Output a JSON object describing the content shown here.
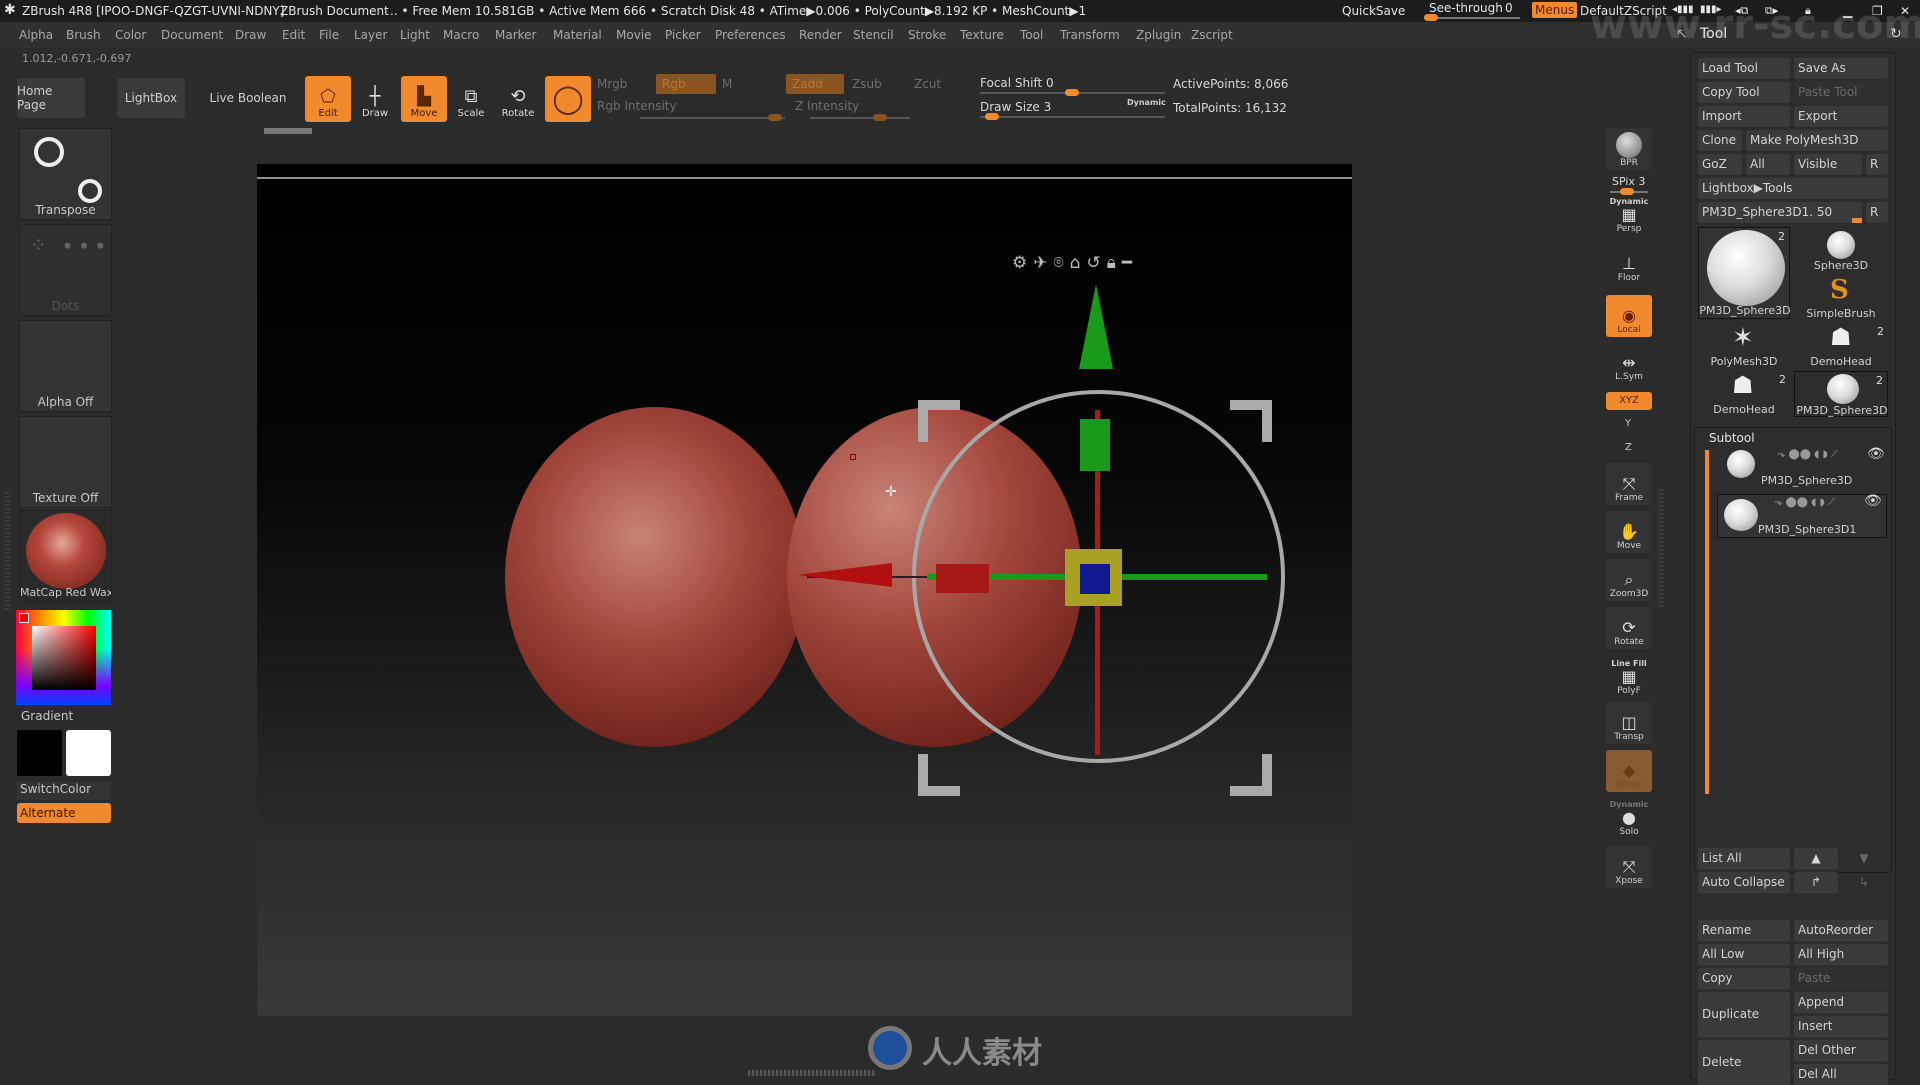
{
  "titlebar": {
    "app_title": "ZBrush 4R8 [IPOO-DNGF-QZGT-UVNI-NDNY]",
    "document": "ZBrush Document",
    "stats": ".. • Free Mem 10.581GB • Active Mem 666 • Scratch Disk 48 • ATime▶0.006 • PolyCount▶8.192 KP • MeshCount▶1",
    "quicksave": "QuickSave",
    "see_through_label": "See-through",
    "see_through_value": "0",
    "see_through_fraction": 0.0,
    "menus_label": "Menus",
    "default_zscript": "DefaultZScript",
    "window_icons": [
      "palette-left-icon",
      "palette-right-icon",
      "layout-left-icon",
      "layout-right-icon",
      "lock-icon",
      "minimize-icon",
      "restore-icon",
      "close-icon"
    ]
  },
  "menubar": {
    "items": [
      "Alpha",
      "Brush",
      "Color",
      "Document",
      "Draw",
      "Edit",
      "File",
      "Layer",
      "Light",
      "Macro",
      "Marker",
      "Material",
      "Movie",
      "Picker",
      "Preferences",
      "Render",
      "Stencil",
      "Stroke",
      "Texture",
      "Tool",
      "Transform",
      "Zplugin",
      "Zscript"
    ]
  },
  "coords": "1.012,-0.671,-0.697",
  "toolbar": {
    "home_page": "Home Page",
    "lightbox": "LightBox",
    "live_boolean": "Live Boolean",
    "edit": "Edit",
    "draw": "Draw",
    "move": "Move",
    "scale": "Scale",
    "rotate": "Rotate",
    "mrgb": "Mrgb",
    "rgb": "Rgb",
    "m": "M",
    "rgb_intensity": "Rgb Intensity",
    "zadd": "Zadd",
    "zsub": "Zsub",
    "zcut": "Zcut",
    "z_intensity": "Z Intensity",
    "focal_shift_label": "Focal Shift",
    "focal_shift_value": "0",
    "draw_size_label": "Draw Size",
    "draw_size_value": "3",
    "dynamic": "Dynamic",
    "active_points": "ActivePoints: 8,066",
    "total_points": "TotalPoints: 16,132"
  },
  "left_shelf": {
    "transpose": "Transpose",
    "dots": "Dots",
    "alpha": "Alpha Off",
    "texture": "Texture Off",
    "material": "MatCap Red Wax",
    "gradient": "Gradient",
    "switch_color": "SwitchColor",
    "alternate": "Alternate",
    "primary_color": "#000000",
    "secondary_color": "#ffffff"
  },
  "viewport": {
    "gizmo_icons": [
      "gear-icon",
      "pin-icon",
      "location-icon",
      "home-icon",
      "undo-icon",
      "lock-icon",
      "minus-icon"
    ]
  },
  "right_shelf": {
    "bpr": "BPR",
    "spix_label": "SPix 3",
    "dynamic": "Dynamic",
    "persp": "Persp",
    "floor": "Floor",
    "local": "Local",
    "lsym": "L.Sym",
    "xyz": "XYZ",
    "y": "Y",
    "z": "Z",
    "frame": "Frame",
    "move": "Move",
    "zoom3d": "Zoom3D",
    "rotate": "Rotate",
    "line_fill": "Line Fill",
    "polyf": "PolyF",
    "transp": "Transp",
    "ghost": "Ghost",
    "dynamic2": "Dynamic",
    "solo": "Solo",
    "xpose": "Xpose"
  },
  "tool_panel": {
    "title": "Tool",
    "load_tool": "Load Tool",
    "save_as": "Save As",
    "copy_tool": "Copy Tool",
    "paste_tool": "Paste Tool",
    "import": "Import",
    "export": "Export",
    "clone": "Clone",
    "make_polymesh": "Make PolyMesh3D",
    "goz": "GoZ",
    "all": "All",
    "visible": "Visible",
    "r": "R",
    "lightbox_tools": "Lightbox▶Tools",
    "current_tool": "PM3D_Sphere3D1. 50",
    "tools": [
      {
        "name": "PM3D_Sphere3D",
        "badge": "2"
      },
      {
        "name": "Sphere3D",
        "badge": ""
      },
      {
        "name": "SimpleBrush",
        "badge": ""
      },
      {
        "name": "PolyMesh3D",
        "badge": ""
      },
      {
        "name": "DemoHead",
        "badge": "2"
      },
      {
        "name": "DemoHead",
        "badge": "2"
      },
      {
        "name": "PM3D_Sphere3D",
        "badge": "2"
      }
    ],
    "subtool_title": "Subtool",
    "subtools": [
      {
        "name": "PM3D_Sphere3D"
      },
      {
        "name": "PM3D_Sphere3D1"
      }
    ],
    "list_all": "List All",
    "auto_collapse": "Auto Collapse",
    "rename": "Rename",
    "auto_reorder": "AutoReorder",
    "all_low": "All Low",
    "all_high": "All High",
    "copy": "Copy",
    "paste": "Paste",
    "duplicate": "Duplicate",
    "append": "Append",
    "insert": "Insert",
    "delete": "Delete",
    "del_other": "Del Other",
    "del_all": "Del All"
  },
  "watermark": {
    "url": "www.rr-sc.com",
    "brand": "人人素材"
  },
  "colors": {
    "accent": "#f08a2c",
    "panel": "#2d2d2d",
    "titlebar": "#1c1c1c"
  }
}
